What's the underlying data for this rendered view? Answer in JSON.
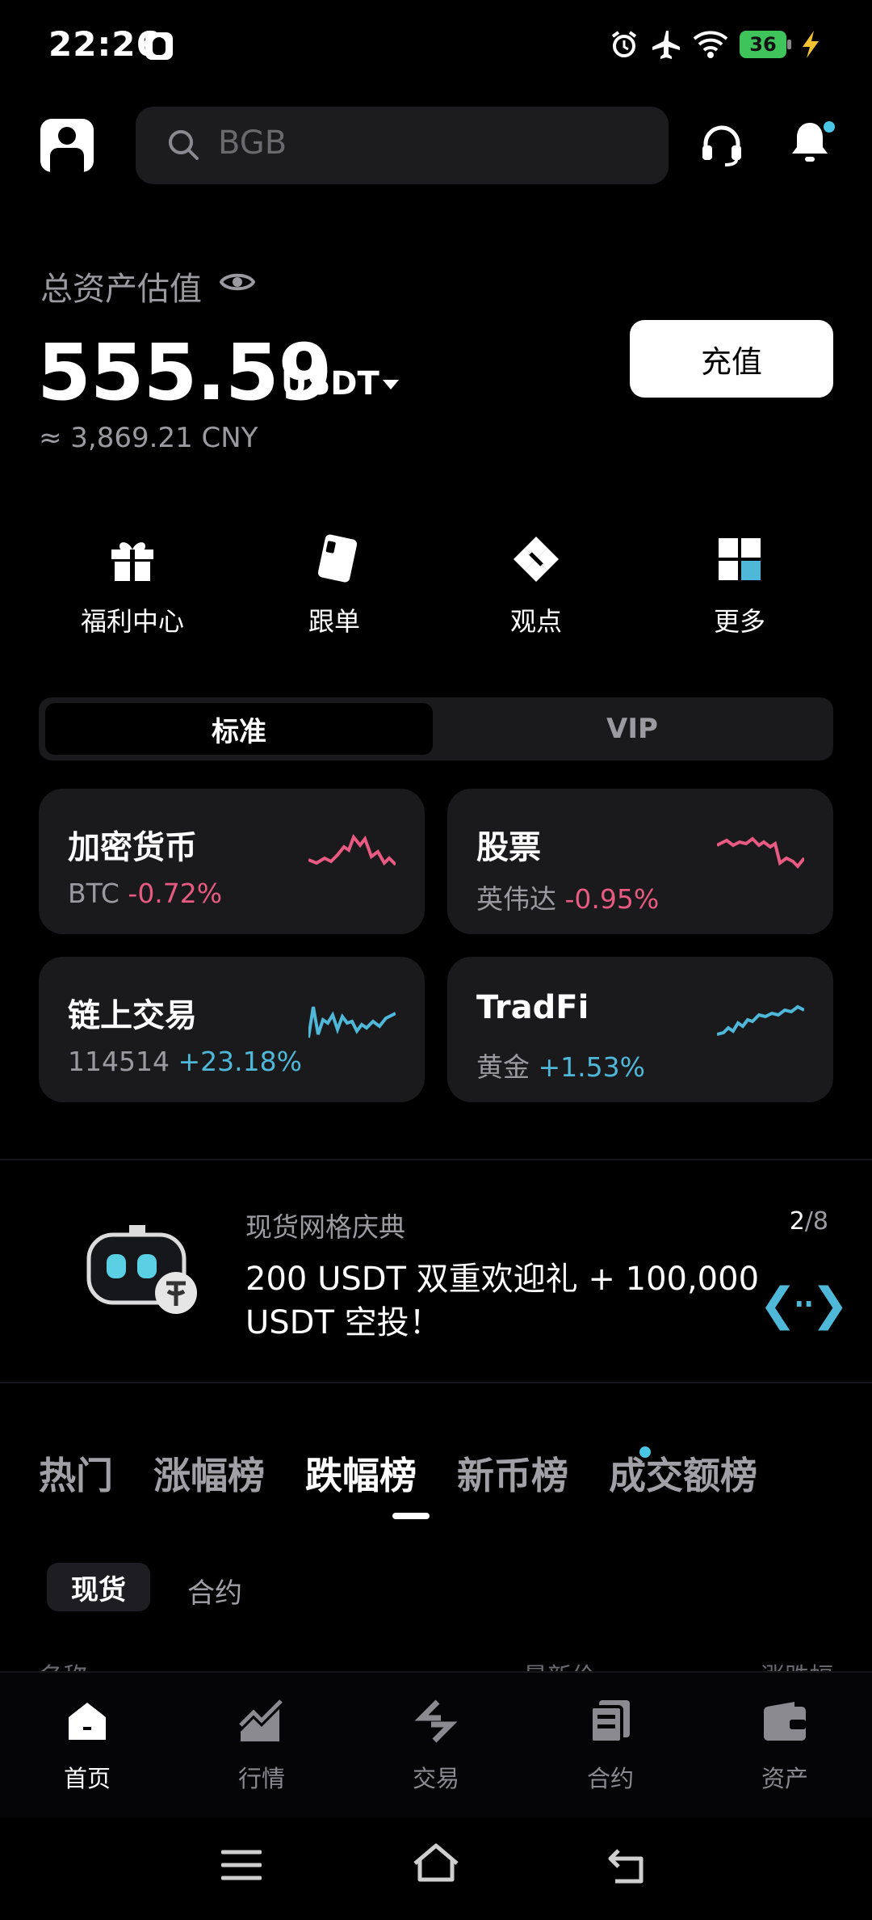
{
  "status_bar": {
    "time": "22:26",
    "battery": "36"
  },
  "header": {
    "search_placeholder": "BGB"
  },
  "assets": {
    "label": "总资产估值",
    "value": "555.59",
    "unit": "USDT",
    "cny": "≈ 3,869.21 CNY",
    "deposit_label": "充值"
  },
  "quick_actions": [
    {
      "label": "福利中心",
      "icon": "gift-icon"
    },
    {
      "label": "跟单",
      "icon": "copy-trade-icon"
    },
    {
      "label": "观点",
      "icon": "insights-icon"
    },
    {
      "label": "更多",
      "icon": "grid-more-icon"
    }
  ],
  "mode_switch": {
    "active": "标准",
    "inactive": "VIP"
  },
  "market_cards": [
    {
      "title": "加密货币",
      "symbol": "BTC",
      "change": "-0.72%",
      "trend": "neg"
    },
    {
      "title": "股票",
      "symbol": "英伟达",
      "change": "-0.95%",
      "trend": "neg"
    },
    {
      "title": "链上交易",
      "symbol": "114514",
      "change": "+23.18%",
      "trend": "pos"
    },
    {
      "title": "TradFi",
      "symbol": "黄金",
      "change": "+1.53%",
      "trend": "pos"
    }
  ],
  "promo": {
    "title": "现货网格庆典",
    "page_current": "2",
    "page_total": "/8",
    "text": "200 USDT 双重欢迎礼 + 100,000 USDT 空投！",
    "colors": {
      "accent": "#4fb8d8"
    }
  },
  "ranking": {
    "tabs": [
      "热门",
      "涨幅榜",
      "跌幅榜",
      "新币榜",
      "成交额榜"
    ],
    "active_tab": "跌幅榜",
    "subtabs": {
      "active": "现货",
      "other": "合约"
    },
    "columns": {
      "name": "名称",
      "price": "最新价",
      "change": "涨跌幅"
    }
  },
  "bottom_nav": [
    {
      "label": "首页",
      "icon": "home-icon"
    },
    {
      "label": "行情",
      "icon": "market-chart-icon"
    },
    {
      "label": "交易",
      "icon": "trade-swap-icon"
    },
    {
      "label": "合约",
      "icon": "futures-icon"
    },
    {
      "label": "资产",
      "icon": "wallet-icon"
    }
  ],
  "colors": {
    "negative": "#e85a82",
    "positive": "#4fb8d8"
  }
}
